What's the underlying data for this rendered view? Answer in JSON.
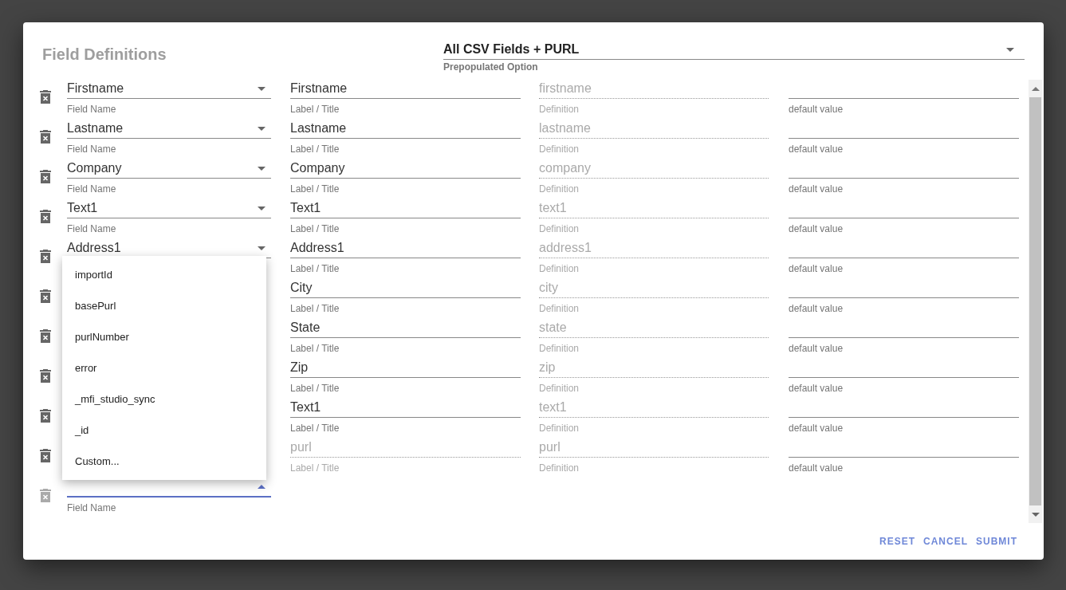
{
  "dialog": {
    "title": "Field Definitions",
    "prepopulated": {
      "value": "All CSV Fields + PURL",
      "hint": "Prepopulated Option"
    },
    "rows": [
      {
        "delete_disabled": false,
        "field": {
          "value": "Firstname",
          "hint": "Field Name"
        },
        "label": {
          "value": "Firstname",
          "hint": "Label / Title",
          "disabled": false
        },
        "definition": {
          "value": "firstname",
          "hint": "Definition",
          "disabled": true
        },
        "default": {
          "hint": "default value"
        }
      },
      {
        "delete_disabled": false,
        "field": {
          "value": "Lastname",
          "hint": "Field Name"
        },
        "label": {
          "value": "Lastname",
          "hint": "Label / Title",
          "disabled": false
        },
        "definition": {
          "value": "lastname",
          "hint": "Definition",
          "disabled": true
        },
        "default": {
          "hint": "default value"
        }
      },
      {
        "delete_disabled": false,
        "field": {
          "value": "Company",
          "hint": "Field Name"
        },
        "label": {
          "value": "Company",
          "hint": "Label / Title",
          "disabled": false
        },
        "definition": {
          "value": "company",
          "hint": "Definition",
          "disabled": true
        },
        "default": {
          "hint": "default value"
        }
      },
      {
        "delete_disabled": false,
        "field": {
          "value": "Text1",
          "hint": "Field Name"
        },
        "label": {
          "value": "Text1",
          "hint": "Label / Title",
          "disabled": false
        },
        "definition": {
          "value": "text1",
          "hint": "Definition",
          "disabled": true
        },
        "default": {
          "hint": "default value"
        }
      },
      {
        "delete_disabled": false,
        "field": {
          "value": "Address1"
        },
        "label": {
          "value": "Address1",
          "hint": "Label / Title",
          "disabled": false
        },
        "definition": {
          "value": "address1",
          "hint": "Definition",
          "disabled": true
        },
        "default": {
          "hint": "default value"
        }
      },
      {
        "delete_disabled": false,
        "label": {
          "value": "City",
          "hint": "Label / Title",
          "disabled": false
        },
        "definition": {
          "value": "city",
          "hint": "Definition",
          "disabled": true
        },
        "default": {
          "hint": "default value"
        }
      },
      {
        "delete_disabled": false,
        "label": {
          "value": "State",
          "hint": "Label / Title",
          "disabled": false
        },
        "definition": {
          "value": "state",
          "hint": "Definition",
          "disabled": true
        },
        "default": {
          "hint": "default value"
        }
      },
      {
        "delete_disabled": false,
        "label": {
          "value": "Zip",
          "hint": "Label / Title",
          "disabled": false
        },
        "definition": {
          "value": "zip",
          "hint": "Definition",
          "disabled": true
        },
        "default": {
          "hint": "default value"
        }
      },
      {
        "delete_disabled": false,
        "label": {
          "value": "Text1",
          "hint": "Label / Title",
          "disabled": false
        },
        "definition": {
          "value": "text1",
          "hint": "Definition",
          "disabled": true
        },
        "default": {
          "hint": "default value"
        }
      },
      {
        "delete_disabled": false,
        "label": {
          "value": "purl",
          "hint": "Label / Title",
          "disabled": true
        },
        "definition": {
          "value": "purl",
          "hint": "Definition",
          "disabled": true
        },
        "default": {
          "hint": "default value"
        }
      },
      {
        "delete_disabled": true,
        "field": {
          "hint": "Field Name",
          "focused": true,
          "expanded": true
        }
      }
    ],
    "menu": {
      "items": [
        "importId",
        "basePurl",
        "purlNumber",
        "error",
        "_mfi_studio_sync",
        "_id",
        "Custom..."
      ]
    },
    "buttons": [
      "RESET",
      "CANCEL",
      "SUBMIT"
    ]
  }
}
